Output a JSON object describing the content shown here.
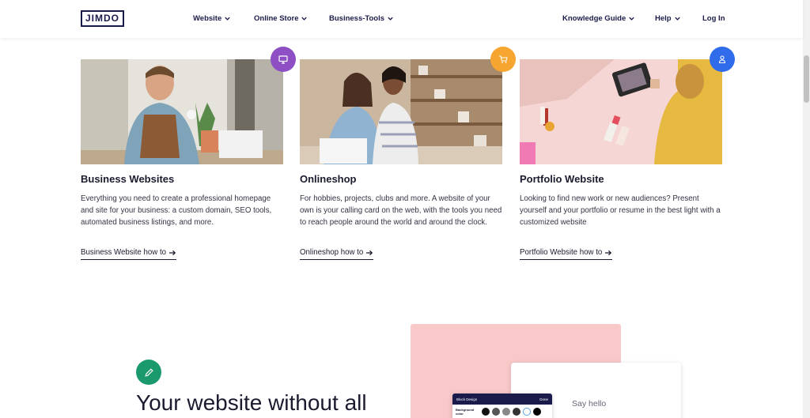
{
  "header": {
    "logo": "JIMDO",
    "nav": [
      {
        "label": "Website"
      },
      {
        "label": "Online Store"
      },
      {
        "label": "Business-Tools"
      }
    ],
    "right_nav": [
      {
        "label": "Knowledge Guide"
      },
      {
        "label": "Help"
      }
    ],
    "login": "Log In"
  },
  "cards": [
    {
      "title": "Business Websites",
      "description": "Everything you need to create a professional homepage and site for your business: a custom domain, SEO tools, automated business listings, and more.",
      "link": "Business Website how to",
      "badge_color": "#8e4fc4",
      "badge_icon": "monitor-icon"
    },
    {
      "title": "Onlineshop",
      "description": "For hobbies, projects, clubs and more. A website of your own is your calling card on the web, with the tools you need to reach people around the world and around the clock.",
      "link": "Onlineshop how to",
      "badge_color": "#f6a530",
      "badge_icon": "cart-icon"
    },
    {
      "title": "Portfolio Website",
      "description": "Looking to find new work or new audiences? Present yourself and your portfolio or resume in the best light with a customized website",
      "link": "Portfolio Website how to",
      "badge_color": "#2f6bea",
      "badge_icon": "person-icon"
    }
  ],
  "feature": {
    "heading": "Your website without all",
    "badge_color": "#1a9a6c",
    "badge_icon": "pencil-icon",
    "say_hello": "Say hello",
    "panel_title": "Block Design",
    "panel_done": "Done",
    "panel_label": "Background color"
  }
}
